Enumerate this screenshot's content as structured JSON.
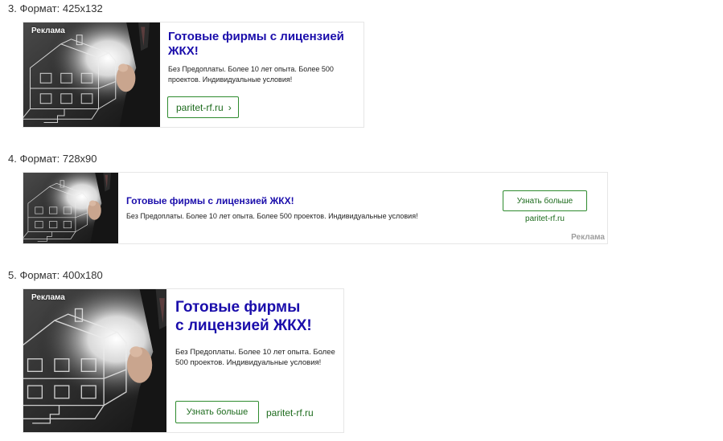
{
  "sections": [
    {
      "label": "3. Формат: 425х132"
    },
    {
      "label": "4. Формат: 728х90"
    },
    {
      "label": "5. Формат: 400х180"
    }
  ],
  "ad": {
    "badge": "Реклама",
    "title_full": "Готовые фирмы с лицензией ЖКХ!",
    "title_line1": "Готовые фирмы",
    "title_line2": "с лицензией ЖКХ!",
    "description": "Без Предоплаты. Более 10 лет опыта. Более 500 проектов. Индивидуальные условия!",
    "domain": "paritet-rf.ru",
    "button_label": "Узнать больше",
    "chevron": "›"
  },
  "colors": {
    "title": "#1a0dab",
    "domain": "#1d6b1d",
    "button_border": "#2e8b2e",
    "badge_gray": "#9e9e9e"
  },
  "icons": {
    "chevron": "chevron-right-icon"
  }
}
